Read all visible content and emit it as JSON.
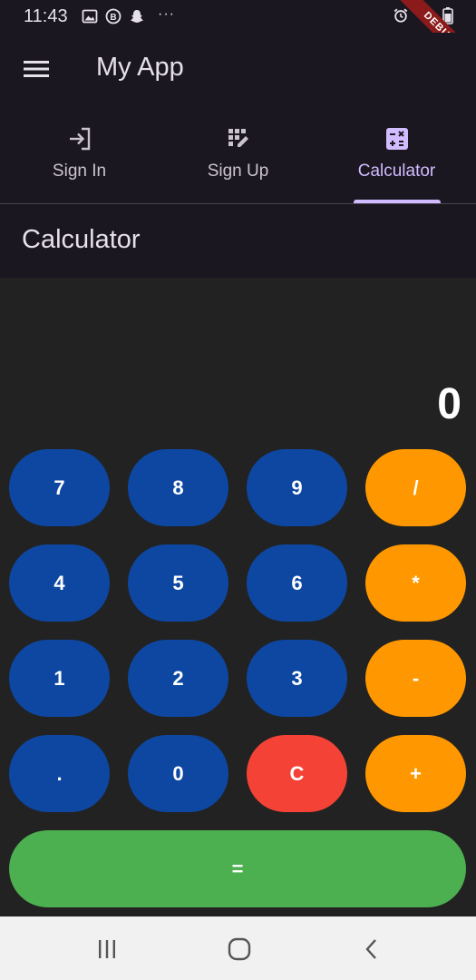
{
  "status_bar": {
    "time": "11:43",
    "left_icons": [
      "image-icon",
      "b-circle-icon",
      "snapchat-icon"
    ],
    "overflow": "···",
    "right_icons": [
      "alarm-icon",
      "wifi-icon",
      "battery-icon"
    ]
  },
  "debug_banner": "DEBUG",
  "app_bar": {
    "title": "My App",
    "menu_icon": "menu-icon"
  },
  "tabs": [
    {
      "label": "Sign In",
      "icon": "login-icon",
      "active": false
    },
    {
      "label": "Sign Up",
      "icon": "app-registration-icon",
      "active": false
    },
    {
      "label": "Calculator",
      "icon": "calculate-icon",
      "active": true
    }
  ],
  "section": {
    "title": "Calculator"
  },
  "calculator": {
    "display": "0",
    "rows": [
      [
        "7",
        "8",
        "9",
        "/"
      ],
      [
        "4",
        "5",
        "6",
        "*"
      ],
      [
        "1",
        "2",
        "3",
        "-"
      ],
      [
        ".",
        "0",
        "C",
        "+"
      ]
    ],
    "equals": "="
  },
  "colors": {
    "background": "#1b1720",
    "calc_background": "#222222",
    "number_key": "#0d47a1",
    "operator_key": "#ff9800",
    "clear_key": "#f44336",
    "equals_key": "#4caf50",
    "accent": "#d0bcff"
  },
  "nav_bar": [
    "recents-icon",
    "home-icon",
    "back-icon"
  ]
}
